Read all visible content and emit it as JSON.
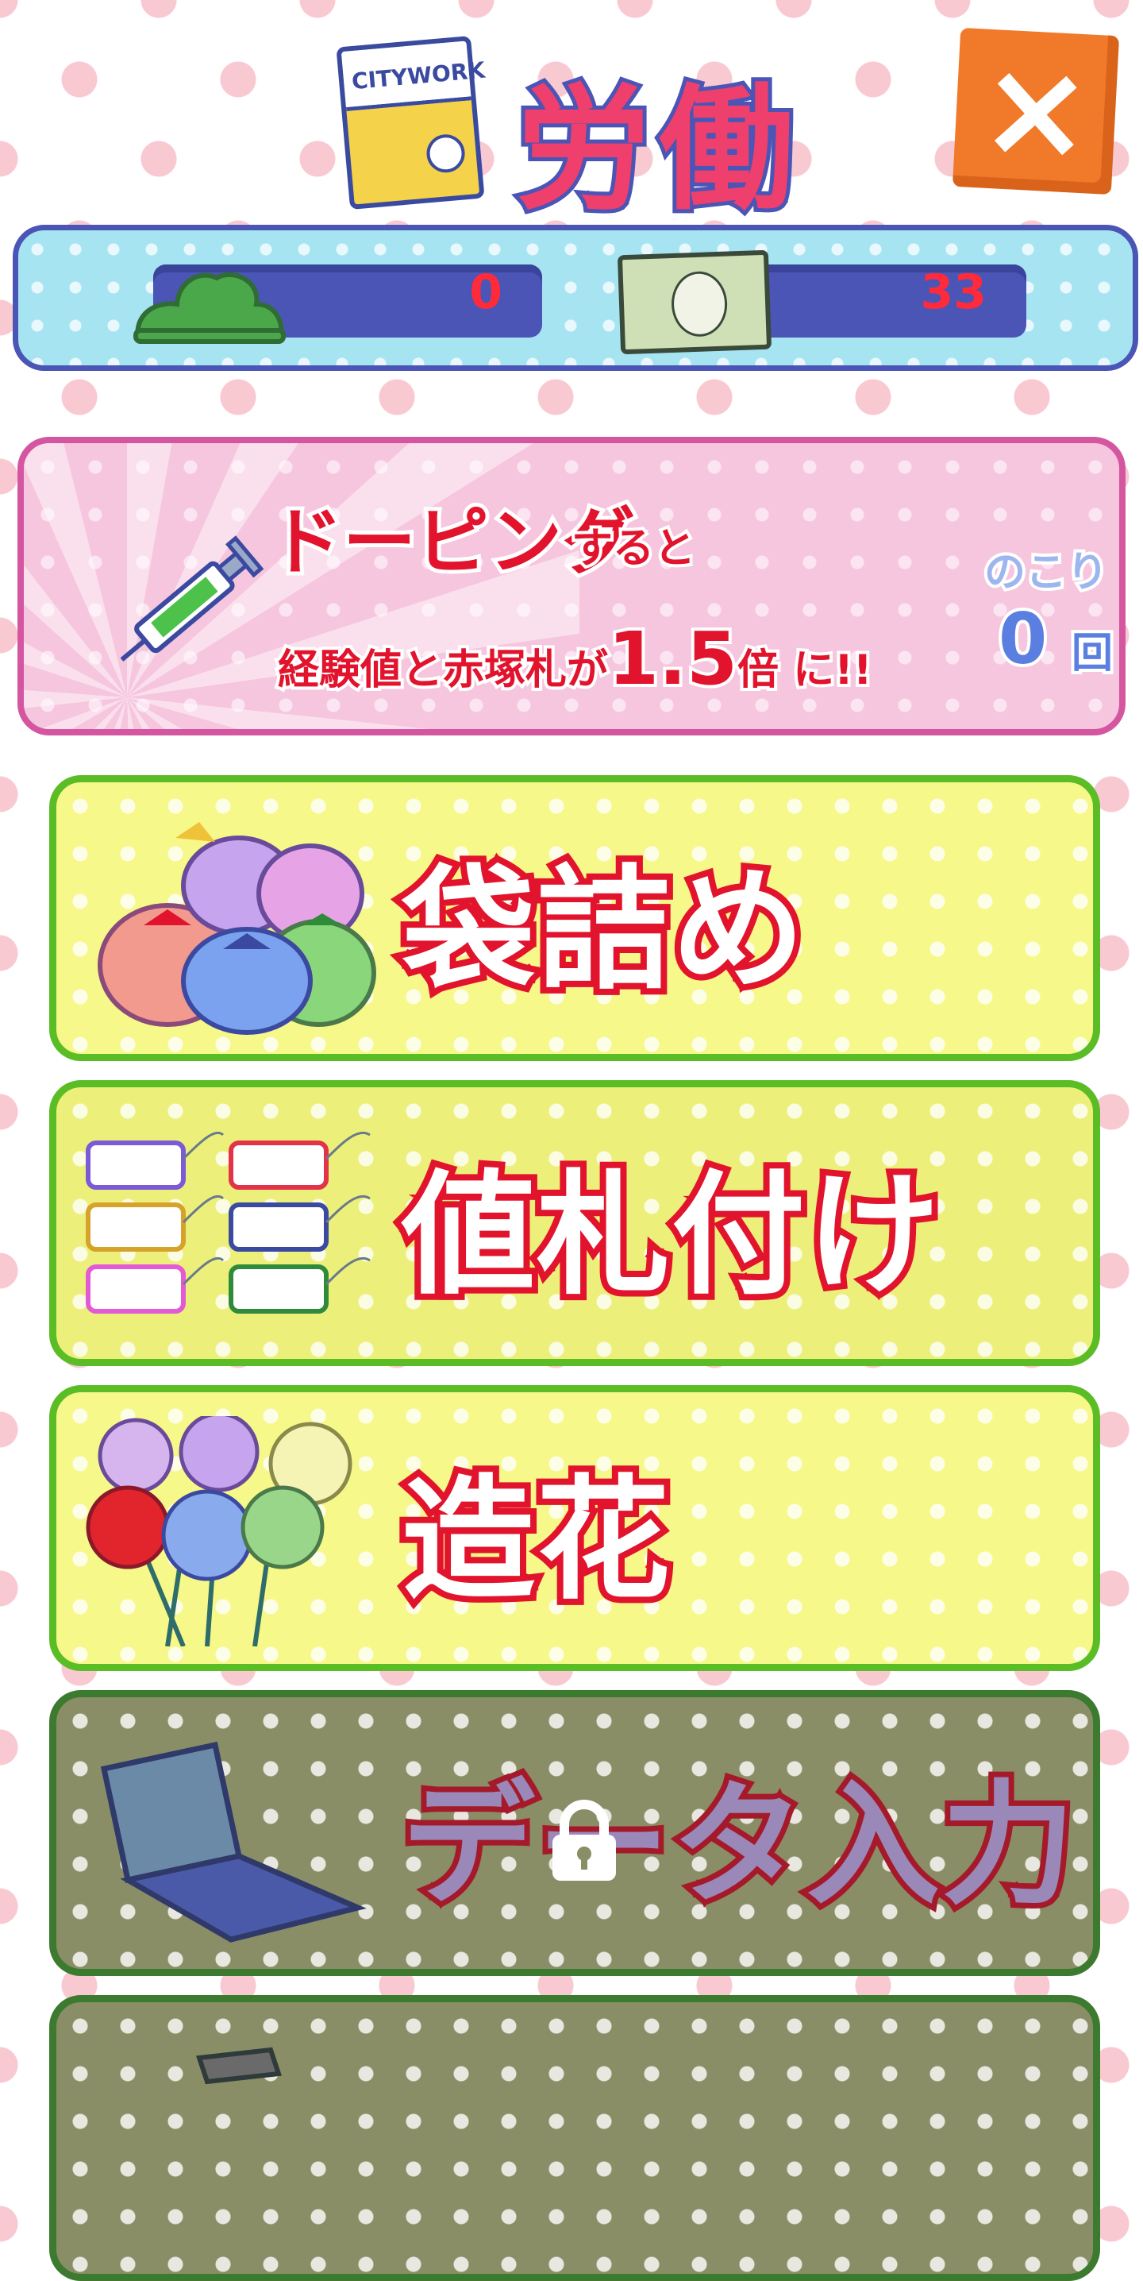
{
  "header": {
    "title": "労働",
    "magazine_label": "CITYWORK",
    "close_label": "×"
  },
  "stats": {
    "pine_count": "0",
    "money_count": "33"
  },
  "doping": {
    "title": "ドーピング",
    "title_suffix": "すると",
    "line2_prefix": "経験値と赤塚札が",
    "multiplier": "1.5",
    "multiplier_unit": "倍",
    "line2_suffix": "に!!",
    "remaining_label": "のこり",
    "remaining_count": "0",
    "remaining_unit": "回"
  },
  "jobs": [
    {
      "label": "袋詰め",
      "locked": false,
      "bg": "#f6f889"
    },
    {
      "label": "値札付け",
      "locked": false,
      "bg": "#ecf07a"
    },
    {
      "label": "造花",
      "locked": false,
      "bg": "#f6f889"
    },
    {
      "label": "データ入力",
      "locked": true,
      "bg": "#8a8e66"
    }
  ],
  "colors": {
    "accent_red": "#e2142d",
    "frame_blue": "#4a55b6",
    "job_border_green": "#5bbd26",
    "close_orange": "#f07a2a"
  }
}
